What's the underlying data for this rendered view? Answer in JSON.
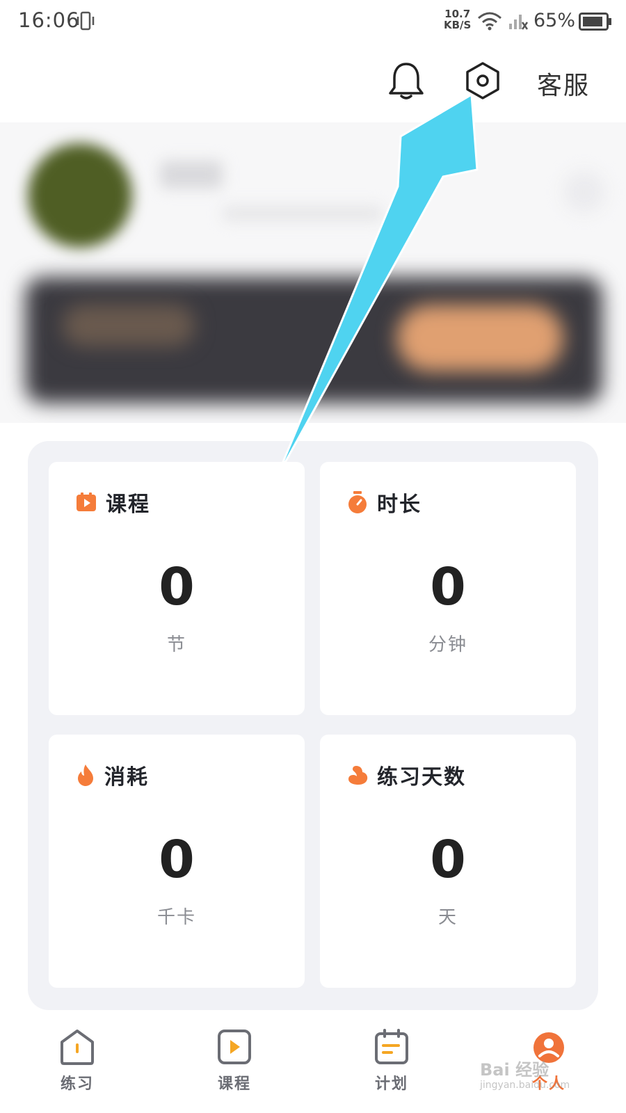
{
  "status_bar": {
    "time": "16:06",
    "net_speed_value": "10.7",
    "net_speed_unit": "KB/S",
    "battery": "65%"
  },
  "header": {
    "notification_icon": "bell-icon",
    "settings_icon": "settings-icon",
    "service_label": "客服"
  },
  "stats": [
    {
      "title": "课程",
      "value": "0",
      "unit": "节",
      "icon": "course-icon",
      "icon_color": "#f57c3a"
    },
    {
      "title": "时长",
      "value": "0",
      "unit": "分钟",
      "icon": "stopwatch-icon",
      "icon_color": "#f57c3a"
    },
    {
      "title": "消耗",
      "value": "0",
      "unit": "千卡",
      "icon": "flame-icon",
      "icon_color": "#f57c3a"
    },
    {
      "title": "练习天数",
      "value": "0",
      "unit": "天",
      "icon": "muscle-icon",
      "icon_color": "#f57c3a"
    }
  ],
  "nav": [
    {
      "label": "练习",
      "icon": "home-icon"
    },
    {
      "label": "课程",
      "icon": "play-icon"
    },
    {
      "label": "计划",
      "icon": "calendar-icon"
    },
    {
      "label": "个人",
      "icon": "profile-icon",
      "active": true
    }
  ],
  "watermark": {
    "brand": "Bai 经验",
    "site": "jingyan.baidu.com"
  },
  "colors": {
    "accent": "#f57c3a",
    "arrow": "#4fd3f0",
    "panel": "#f1f2f6"
  }
}
